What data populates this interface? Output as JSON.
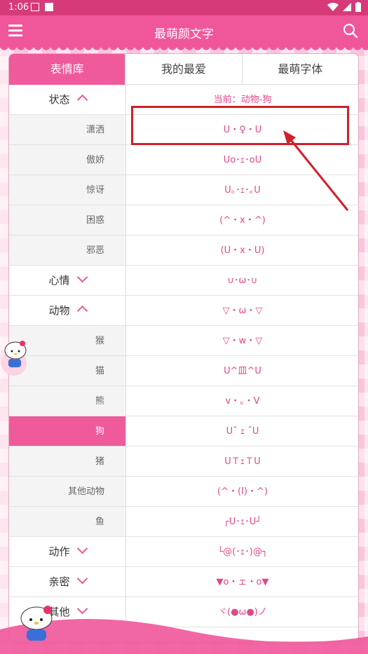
{
  "status_bar": {
    "time": "1:06"
  },
  "app_bar": {
    "title": "最萌颜文字"
  },
  "tabs": [
    {
      "label": "表情库",
      "active": true
    },
    {
      "label": "我的最爱",
      "active": false
    },
    {
      "label": "最萌字体",
      "active": false
    }
  ],
  "current_label": "当前：动物-狗",
  "categories": [
    {
      "label": "状态",
      "expanded": true
    },
    {
      "label": "心情",
      "expanded": false
    },
    {
      "label": "动物",
      "expanded": true
    },
    {
      "label": "动作",
      "expanded": false
    },
    {
      "label": "亲密",
      "expanded": false
    },
    {
      "label": "其他",
      "expanded": false
    }
  ],
  "status_items": [
    "潇洒",
    "傲娇",
    "惊讶",
    "困惑",
    "邪恶"
  ],
  "animal_items": [
    "猴",
    "猫",
    "熊",
    "狗",
    "猪",
    "其他动物",
    "鱼"
  ],
  "selected_item": "狗",
  "emoticons": [
    "U・♀・U",
    "Uo･ｪ･oU",
    "U｡･ｪ･｡U",
    "(^・x・^)",
    "(U・x・U)",
    "∪･ω･∪",
    "▽・ω・▽",
    "▽・w・▽",
    "U^皿^U",
    "v・。・V",
    "Uˆ ｪ ˆU",
    "UＴｪＴU",
    "(^・(I)・^)",
    "┌U･ｪ･U┘",
    "└@(･ｪ･)@┐",
    "▼o・ェ・o▼",
    "ヾ(●ω●)ノ"
  ],
  "colors": {
    "accent": "#ef5a9b",
    "emoticon": "#e0488a",
    "annotation": "#d11f2b"
  }
}
